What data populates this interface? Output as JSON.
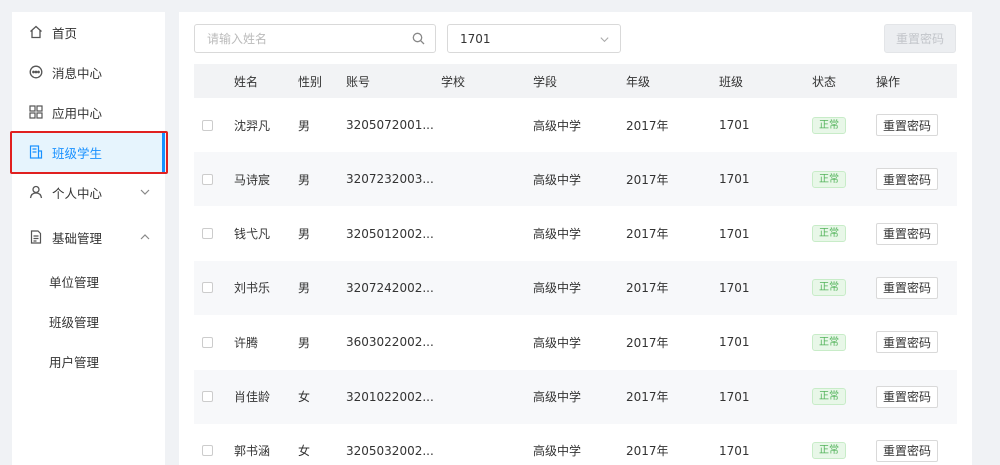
{
  "sidebar": {
    "items": [
      {
        "label": "首页",
        "icon": "home-icon"
      },
      {
        "label": "消息中心",
        "icon": "message-icon"
      },
      {
        "label": "应用中心",
        "icon": "apps-icon"
      },
      {
        "label": "班级学生",
        "icon": "class-students-icon",
        "active": true
      },
      {
        "label": "个人中心",
        "icon": "user-icon",
        "expandable": "collapsed"
      },
      {
        "label": "基础管理",
        "icon": "document-icon",
        "expandable": "expanded"
      }
    ],
    "sub_items": [
      {
        "label": "单位管理"
      },
      {
        "label": "班级管理"
      },
      {
        "label": "用户管理"
      }
    ]
  },
  "toolbar": {
    "search_placeholder": "请输入姓名",
    "class_select_value": "1701",
    "reset_password_label": "重置密码"
  },
  "table": {
    "headers": [
      "姓名",
      "性别",
      "账号",
      "学校",
      "学段",
      "年级",
      "班级",
      "状态",
      "操作"
    ],
    "rows": [
      {
        "name": "沈羿凡",
        "gender": "男",
        "account": "3205072001...",
        "school": "",
        "stage": "高级中学",
        "grade": "2017年",
        "class": "1701",
        "status": "正常",
        "action": "重置密码"
      },
      {
        "name": "马诗宸",
        "gender": "男",
        "account": "3207232003...",
        "school": "",
        "stage": "高级中学",
        "grade": "2017年",
        "class": "1701",
        "status": "正常",
        "action": "重置密码"
      },
      {
        "name": "钱弋凡",
        "gender": "男",
        "account": "3205012002...",
        "school": "",
        "stage": "高级中学",
        "grade": "2017年",
        "class": "1701",
        "status": "正常",
        "action": "重置密码"
      },
      {
        "name": "刘书乐",
        "gender": "男",
        "account": "3207242002...",
        "school": "",
        "stage": "高级中学",
        "grade": "2017年",
        "class": "1701",
        "status": "正常",
        "action": "重置密码"
      },
      {
        "name": "许腾",
        "gender": "男",
        "account": "3603022002...",
        "school": "",
        "stage": "高级中学",
        "grade": "2017年",
        "class": "1701",
        "status": "正常",
        "action": "重置密码"
      },
      {
        "name": "肖佳龄",
        "gender": "女",
        "account": "3201022002...",
        "school": "",
        "stage": "高级中学",
        "grade": "2017年",
        "class": "1701",
        "status": "正常",
        "action": "重置密码"
      },
      {
        "name": "郭书涵",
        "gender": "女",
        "account": "3205032002...",
        "school": "",
        "stage": "高级中学",
        "grade": "2017年",
        "class": "1701",
        "status": "正常",
        "action": "重置密码"
      }
    ]
  },
  "colors": {
    "accent": "#1890ff",
    "status_green": "#52b35a",
    "highlight_red": "#e02020"
  }
}
